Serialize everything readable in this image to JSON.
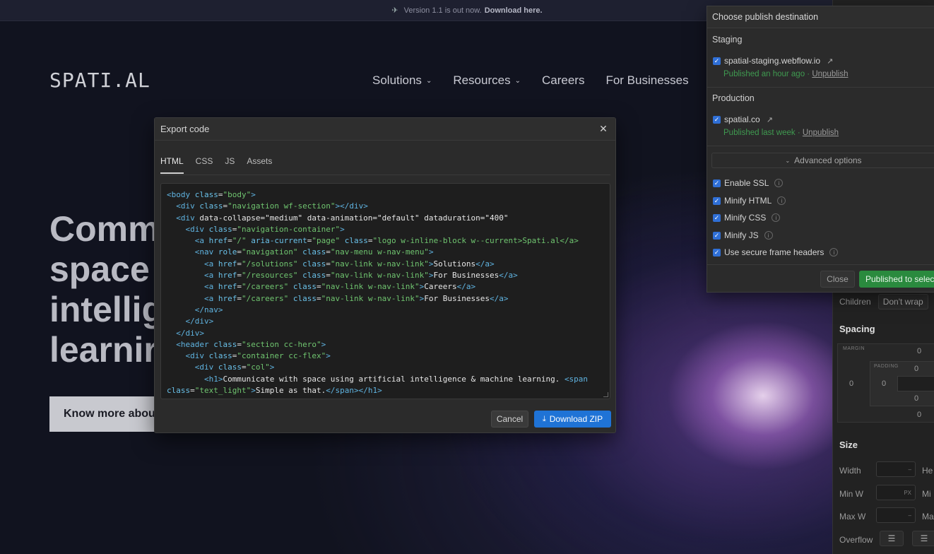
{
  "banner": {
    "text": "Version 1.1 is out now.",
    "link": "Download here."
  },
  "site": {
    "logo": "SPATI.AL",
    "nav": [
      "Solutions",
      "Resources",
      "Careers",
      "For Businesses"
    ],
    "hero_lines": [
      "Comm",
      "space",
      "intellig",
      "learnir"
    ],
    "cta": "Know more about"
  },
  "style_panel": {
    "children_label": "Children",
    "children_value": "Don't wrap",
    "spacing_title": "Spacing",
    "margin_label": "MARGIN",
    "padding_label": "PADDING",
    "margin_top": "0",
    "margin_left": "0",
    "padding_top": "0",
    "padding_left": "0",
    "padding_bottom": "0",
    "margin_bottom": "0",
    "size_title": "Size",
    "width_label": "Width",
    "height_label": "He",
    "minw_label": "Min W",
    "min_label": "Mi",
    "maxw_label": "Max W",
    "max_label": "Ma",
    "overflow_label": "Overflow",
    "px_unit": "PX",
    "dash": "–"
  },
  "publish": {
    "header": "Choose publish destination",
    "staging_title": "Staging",
    "staging_domain": "spatial-staging.webflow.io",
    "staging_meta": "Published an hour ago ·",
    "production_title": "Production",
    "production_domain": "spatial.co",
    "production_meta": "Published last week ·",
    "unpublish": "Unpublish",
    "advanced": "Advanced options",
    "options": [
      "Enable SSL",
      "Minify HTML",
      "Minify CSS",
      "Minify JS",
      "Use secure frame headers"
    ],
    "close": "Close",
    "publish_button": "Published to selected"
  },
  "modal": {
    "title": "Export code",
    "tabs": [
      "HTML",
      "CSS",
      "JS",
      "Assets"
    ],
    "active_tab": "HTML",
    "cancel": "Cancel",
    "download": "Download ZIP"
  },
  "code_lines": [
    "<body class=\"body\">",
    "  <div class=\"navigation wf-section\"></div>",
    "  <div data-collapse=\"medium\" data-animation=\"default\" dataduration=\"400\"",
    "    <div class=\"navigation-container\">",
    "      <a href=\"/\" aria-current=\"page\" class=\"logo w-inline-block w--current>Spati.al</a>",
    "      <nav role=\"navigation\" class=\"nav-menu w-nav-menu\">",
    "        <a href=\"/solutions\" class=\"nav-link w-nav-link\">Solutions</a>",
    "        <a href=\"/resources\" class=\"nav-link w-nav-link\">For Businesses</a>",
    "        <a href=\"/careers\" class=\"nav-link w-nav-link\">Careers</a>",
    "        <a href=\"/careers\" class=\"nav-link w-nav-link\">For Businesses</a>",
    "      </nav>",
    "    </div>",
    "  </div>",
    "  <header class=\"section cc-hero\">",
    "    <div class=\"container cc-flex\">",
    "      <div class=\"col\">",
    "        <h1>Communicate with space using artificial intelligence & machine learning. <span",
    "class=\"text_light\">Simple as that.</span></h1>"
  ]
}
